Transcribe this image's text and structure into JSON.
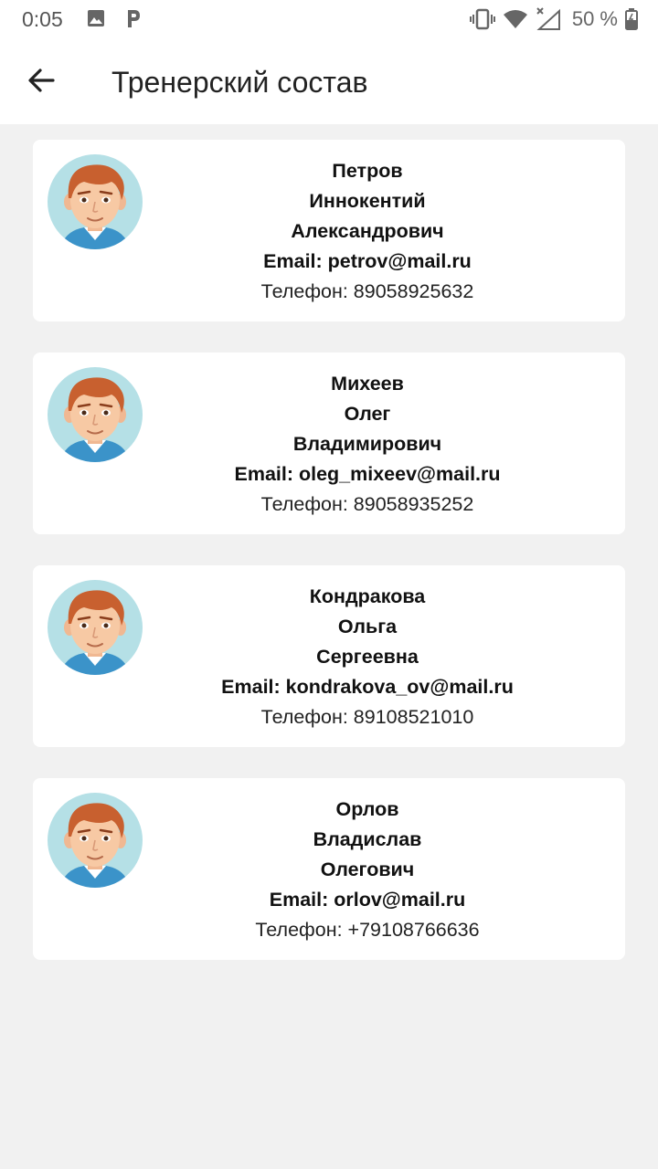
{
  "status_bar": {
    "time": "0:05",
    "battery": "50 %",
    "icons": [
      "image-icon",
      "p-app-icon",
      "vibrate-icon",
      "wifi-icon",
      "no-signal-icon",
      "battery-icon"
    ]
  },
  "app_bar": {
    "back_icon": "arrow-left-icon",
    "title": "Тренерский состав"
  },
  "colors": {
    "background": "#f1f1f1",
    "card": "#ffffff",
    "avatar_bg": "#b5e0e6",
    "hair": "#c8602f",
    "shirt": "#3b93c9"
  },
  "coaches": [
    {
      "surname": "Петров",
      "name": "Иннокентий",
      "patronymic": "Александрович",
      "email": "Email: petrov@mail.ru",
      "phone": "Телефон: 89058925632"
    },
    {
      "surname": "Михеев",
      "name": "Олег",
      "patronymic": "Владимирович",
      "email": "Email: oleg_mixeev@mail.ru",
      "phone": "Телефон: 89058935252"
    },
    {
      "surname": "Кондракова",
      "name": "Ольга",
      "patronymic": "Сергеевна",
      "email": "Email: kondrakova_ov@mail.ru",
      "phone": "Телефон: 89108521010"
    },
    {
      "surname": "Орлов",
      "name": "Владислав",
      "patronymic": "Олегович",
      "email": "Email: orlov@mail.ru",
      "phone": "Телефон: +79108766636"
    }
  ]
}
